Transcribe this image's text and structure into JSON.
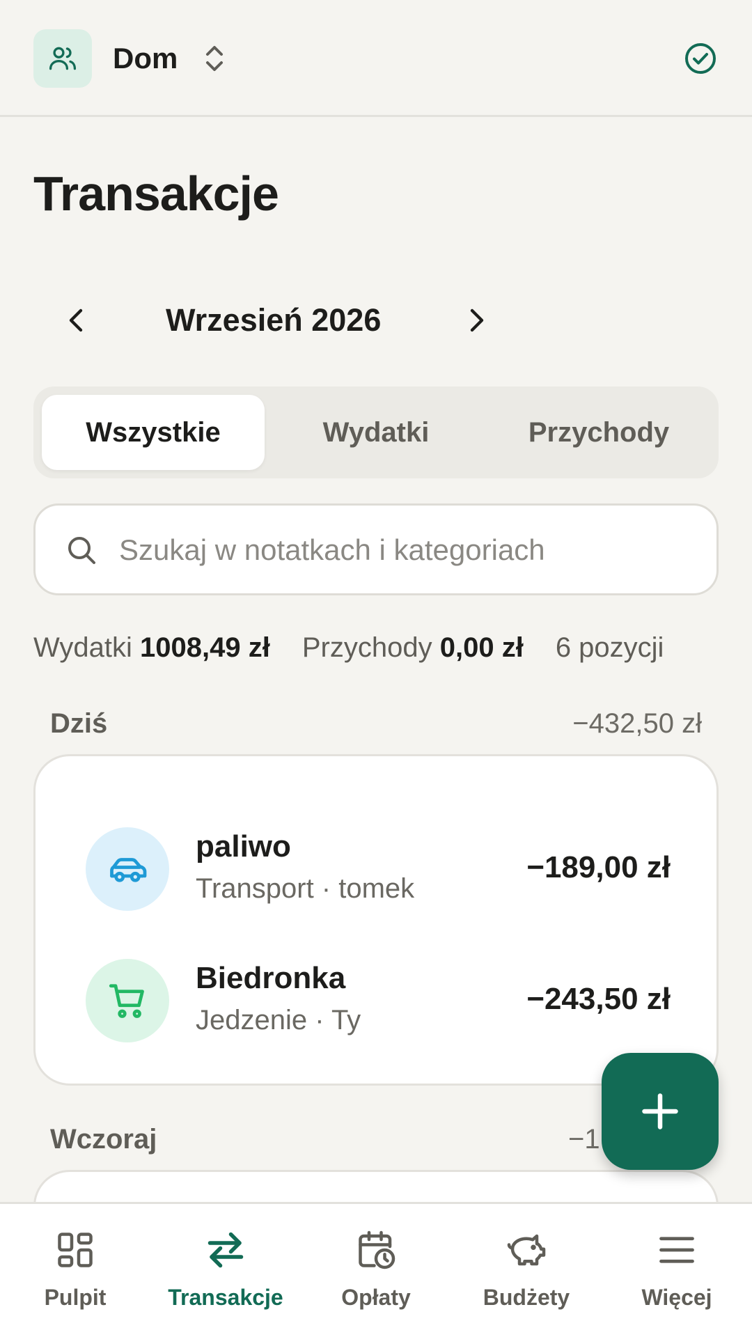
{
  "header": {
    "household_name": "Dom",
    "icons": {
      "household": "users-icon",
      "switch": "chevron-up-down-icon",
      "sync": "check-circle-icon"
    }
  },
  "page": {
    "title": "Transakcje"
  },
  "month_nav": {
    "label": "Wrzesień 2026"
  },
  "filter_tabs": [
    {
      "label": "Wszystkie",
      "active": true
    },
    {
      "label": "Wydatki",
      "active": false
    },
    {
      "label": "Przychody",
      "active": false
    }
  ],
  "search": {
    "placeholder": "Szukaj w notatkach i kategoriach",
    "value": ""
  },
  "summary": {
    "expenses_label": "Wydatki",
    "expenses_value": "1008,49 zł",
    "income_label": "Przychody",
    "income_value": "0,00 zł",
    "count": "6 pozycji"
  },
  "groups": [
    {
      "label": "Dziś",
      "total": "−432,50 zł",
      "transactions": [
        {
          "title": "paliwo",
          "subtitle": "Transport · tomek",
          "amount": "−189,00 zł",
          "icon": "car-icon",
          "icon_bg": "#dcf0fb",
          "icon_color": "#1e9ad6"
        },
        {
          "title": "Biedronka",
          "subtitle": "Jedzenie · Ty",
          "amount": "−243,50 zł",
          "icon": "cart-icon",
          "icon_bg": "#dcf5e7",
          "icon_color": "#22b864"
        }
      ]
    },
    {
      "label": "Wczoraj",
      "total": "−1"
    }
  ],
  "fab": {
    "icon": "plus-icon"
  },
  "bottom_nav": [
    {
      "label": "Pulpit",
      "icon": "dashboard-icon",
      "active": false
    },
    {
      "label": "Transakcje",
      "icon": "transfer-arrows-icon",
      "active": true
    },
    {
      "label": "Opłaty",
      "icon": "calendar-clock-icon",
      "active": false
    },
    {
      "label": "Budżety",
      "icon": "piggy-bank-icon",
      "active": false
    },
    {
      "label": "Więcej",
      "icon": "menu-icon",
      "active": false
    }
  ],
  "colors": {
    "accent": "#126b55",
    "background": "#f5f4f0",
    "surface": "#ffffff"
  }
}
